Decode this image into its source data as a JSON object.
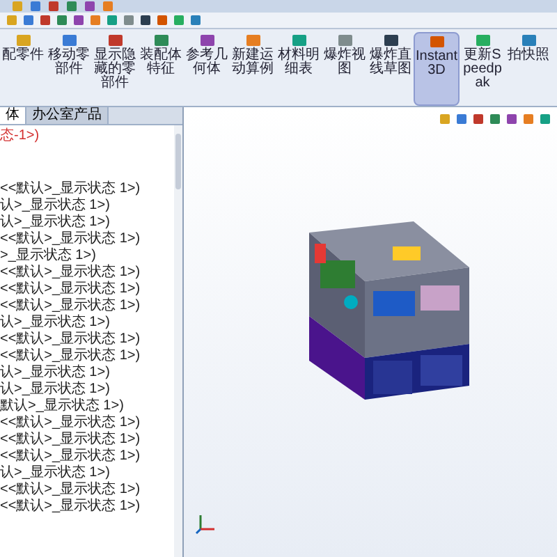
{
  "ribbon": {
    "buttons": [
      {
        "label": "配零件",
        "selected": false
      },
      {
        "label": "移动零部件",
        "selected": false
      },
      {
        "label": "显示隐藏的零部件",
        "selected": false
      },
      {
        "label": "装配体特征",
        "selected": false
      },
      {
        "label": "参考几何体",
        "selected": false
      },
      {
        "label": "新建运动算例",
        "selected": false
      },
      {
        "label": "材料明细表",
        "selected": false
      },
      {
        "label": "爆炸视图",
        "selected": false
      },
      {
        "label": "爆炸直线草图",
        "selected": false
      },
      {
        "label": "Instant3D",
        "selected": true
      },
      {
        "label": "更新Speedpak",
        "selected": false
      },
      {
        "label": "拍快照",
        "selected": false
      }
    ]
  },
  "panel": {
    "tabs": [
      {
        "label": "体",
        "selected": true
      },
      {
        "label": "办公室产品",
        "selected": false
      }
    ],
    "tree": [
      {
        "text": "态-1>)",
        "kind": "error"
      },
      {
        "text": "<<默认>_显示状态 1>)",
        "kind": "item"
      },
      {
        "text": "认>_显示状态 1>)",
        "kind": "item"
      },
      {
        "text": "认>_显示状态 1>)",
        "kind": "item"
      },
      {
        "text": "<<默认>_显示状态 1>)",
        "kind": "item"
      },
      {
        "text": ">_显示状态 1>)",
        "kind": "item"
      },
      {
        "text": "<<默认>_显示状态 1>)",
        "kind": "item"
      },
      {
        "text": "<<默认>_显示状态 1>)",
        "kind": "item"
      },
      {
        "text": "<<默认>_显示状态 1>)",
        "kind": "item"
      },
      {
        "text": "认>_显示状态 1>)",
        "kind": "item"
      },
      {
        "text": "<<默认>_显示状态 1>)",
        "kind": "item"
      },
      {
        "text": "<<默认>_显示状态 1>)",
        "kind": "item"
      },
      {
        "text": "认>_显示状态 1>)",
        "kind": "item"
      },
      {
        "text": "认>_显示状态 1>)",
        "kind": "item"
      },
      {
        "text": "默认>_显示状态 1>)",
        "kind": "item"
      },
      {
        "text": "<<默认>_显示状态 1>)",
        "kind": "item"
      },
      {
        "text": "<<默认>_显示状态 1>)",
        "kind": "item"
      },
      {
        "text": "<<默认>_显示状态 1>)",
        "kind": "item"
      },
      {
        "text": "认>_显示状态 1>)",
        "kind": "item"
      },
      {
        "text": "<<默认>_显示状态 1>)",
        "kind": "item"
      },
      {
        "text": "<<默认>_显示状态 1>)",
        "kind": "item"
      }
    ]
  }
}
